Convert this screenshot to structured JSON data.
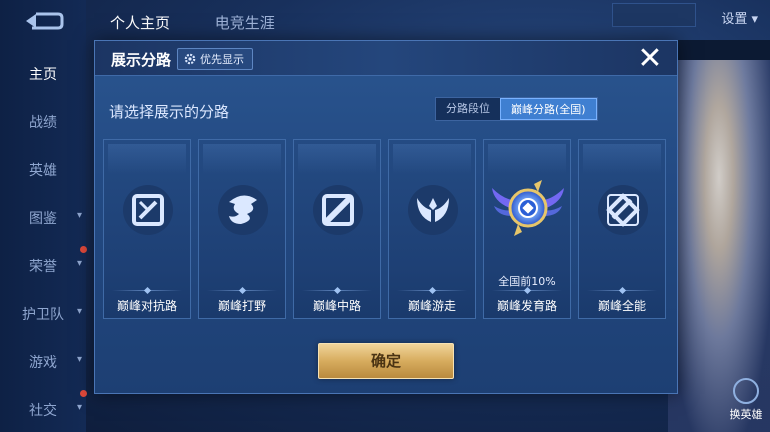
{
  "nav": {
    "items": [
      "主页",
      "战绩",
      "英雄",
      "图鉴",
      "荣誉",
      "护卫队",
      "游戏",
      "社交"
    ]
  },
  "top_tabs": [
    "个人主页",
    "电竞生涯"
  ],
  "settings_label": "设置",
  "right_buttons": [
    "换英雄"
  ],
  "dialog": {
    "title": "展示分路",
    "priority_label": "优先显示",
    "prompt": "请选择展示的分路",
    "segments": [
      "分路段位",
      "巅峰分路(全国)"
    ],
    "selected_segment": "巅峰分路(全国)",
    "cards": [
      {
        "label": "巅峰对抗路",
        "rank": "",
        "icon": "sword-cross-icon"
      },
      {
        "label": "巅峰打野",
        "rank": "",
        "icon": "dragon-icon"
      },
      {
        "label": "巅峰中路",
        "rank": "",
        "icon": "slash-icon"
      },
      {
        "label": "巅峰游走",
        "rank": "",
        "icon": "wings-icon"
      },
      {
        "label": "巅峰发育路",
        "rank": "全国前10%",
        "icon": "winged-emblem-icon"
      },
      {
        "label": "巅峰全能",
        "rank": "",
        "icon": "diamond-cut-icon"
      }
    ],
    "confirm_label": "确定"
  },
  "colors": {
    "dialog_bg": "#234a83",
    "accent_blue": "#3f7fd1",
    "confirm_gold": "#d7ac5e"
  }
}
